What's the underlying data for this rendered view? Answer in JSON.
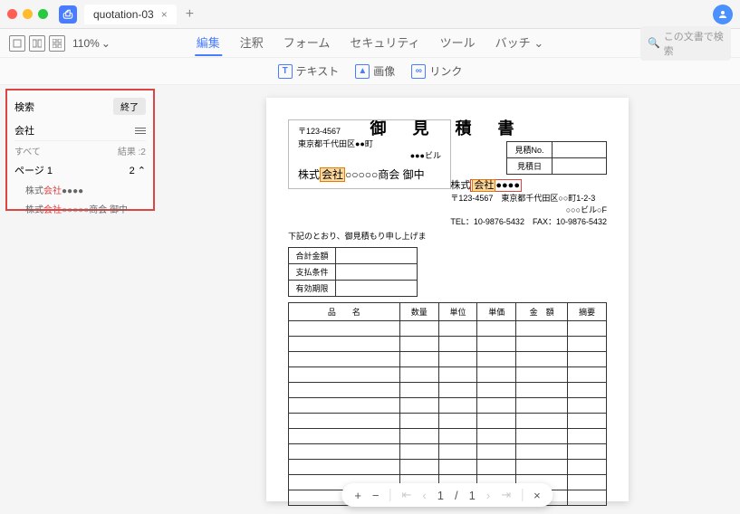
{
  "titlebar": {
    "tab_name": "quotation-03",
    "close": "×",
    "add": "+"
  },
  "toolbar1": {
    "zoom": "110%",
    "tabs": {
      "edit": "編集",
      "annotate": "注釈",
      "form": "フォーム",
      "security": "セキュリティ",
      "tool": "ツール",
      "batch": "バッチ"
    },
    "search_placeholder": "この文書で検索"
  },
  "toolbar2": {
    "text": "テキスト",
    "image": "画像",
    "link": "リンク"
  },
  "search_panel": {
    "title": "検索",
    "end": "終了",
    "term": "会社",
    "all": "すべて",
    "result_label": "結果 :2",
    "page_label": "ページ 1",
    "page_count": "2",
    "results": [
      {
        "pre": "株式",
        "hl": "会社",
        "post": "●●●●"
      },
      {
        "pre": "株式",
        "hl": "会社",
        "post": "○○○○○商会 御中"
      }
    ]
  },
  "doc": {
    "title": "御 見 積 書",
    "recipient": {
      "postal": "〒123-4567",
      "addr": "東京都千代田区●●町",
      "bldg": "●●●ビル",
      "pre": "株式",
      "kaisha": "会社",
      "post": "○○○○○商会 御中"
    },
    "info": {
      "no_label": "見積No.",
      "date_label": "見積日"
    },
    "sender": {
      "pre": "株式",
      "kaisha": "会社",
      "post": "●●●●",
      "postal": "〒123-4567　東京都千代田区○○町1-2-3",
      "bldg": "○○○ビル○F",
      "tel": "TEL：10-9876-5432　FAX：10-9876-5432"
    },
    "note": "下記のとおり、御見積もり申し上げま",
    "summary": {
      "total": "合計金額",
      "payment": "支払条件",
      "valid": "有効期限"
    },
    "headers": {
      "name": "品　　名",
      "qty": "数量",
      "unit": "単位",
      "price": "単価",
      "amount": "金　額",
      "remarks": "摘要"
    }
  },
  "nav": {
    "plus": "+",
    "minus": "−",
    "page": "1",
    "sep": "/",
    "total": "1",
    "close": "×"
  }
}
